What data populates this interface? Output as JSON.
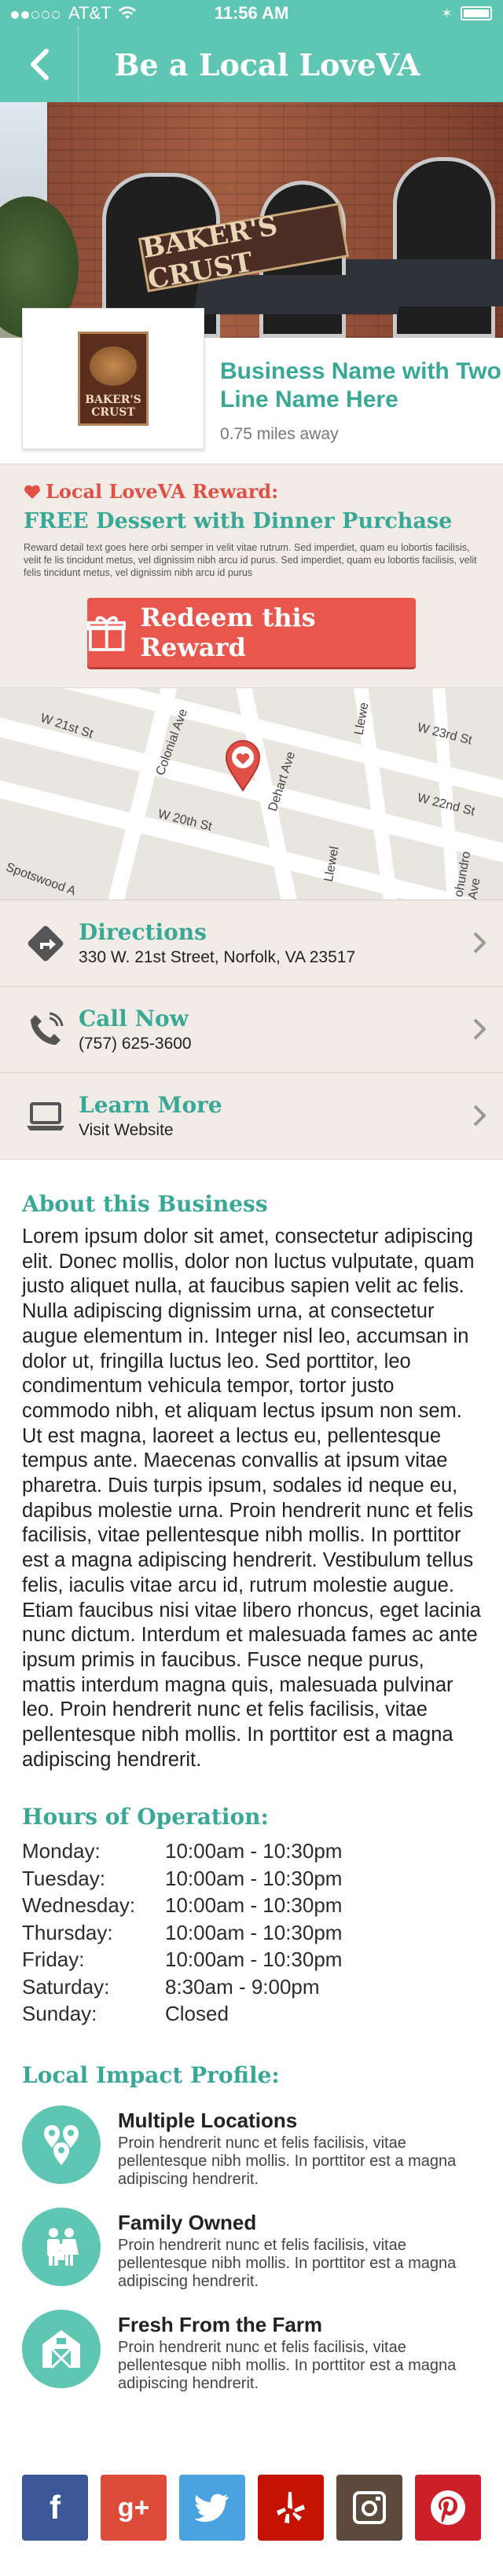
{
  "status_bar": {
    "carrier": "AT&T",
    "time": "11:56 AM"
  },
  "nav": {
    "title": "Be a Local LoveVA"
  },
  "hero": {
    "sign_text": "BAKER'S CRUST"
  },
  "business": {
    "name": "Business Name with Two Line Name Here",
    "distance": "0.75 miles away",
    "logo_text": "BAKER'S CRUST"
  },
  "reward": {
    "label": "Local LoveVA Reward:",
    "offer": "FREE Dessert with Dinner Purchase",
    "detail": "Reward detail text goes here orbi semper in velit vitae rutrum. Sed imperdiet, quam eu lobortis facilisis, velit fe lis tincidunt metus, vel dignissim nibh arcu id purus. Sed imperdiet, quam eu lobortis facilisis, velit felis tincidunt metus, vel dignissim nibh arcu id purus",
    "button_label": "Redeem this Reward"
  },
  "map": {
    "labels": [
      "W 21st St",
      "Colonial Ave",
      "Dehart Ave",
      "Llewe",
      "W 23rd St",
      "W 22nd St",
      "W 20th St",
      "Spotswood A",
      "Llewel",
      "ohundro Ave"
    ]
  },
  "actions": [
    {
      "title": "Directions",
      "subtitle": "330 W. 21st Street, Norfolk, VA 23517",
      "icon": "directions-icon"
    },
    {
      "title": "Call Now",
      "subtitle": "(757) 625-3600",
      "icon": "phone-icon"
    },
    {
      "title": "Learn More",
      "subtitle": "Visit Website",
      "icon": "laptop-icon"
    }
  ],
  "about": {
    "title": "About this Business",
    "body": "Lorem ipsum dolor sit amet, consectetur adipiscing elit. Donec mollis, dolor non luctus vulputate, quam justo aliquet nulla, at faucibus sapien velit ac felis. Nulla adipiscing dignissim urna, at consectetur augue elementum in. Integer nisl leo, accumsan in dolor ut, fringilla luctus leo. Sed porttitor, leo condimentum vehicula tempor, tortor justo commodo nibh, et aliquam lectus ipsum non sem. Ut est magna, laoreet a lectus eu, pellentesque tempus ante. Maecenas convallis at ipsum vitae pharetra. Duis turpis ipsum, sodales id neque eu, dapibus molestie urna. Proin hendrerit nunc et felis facilisis, vitae pellentesque nibh mollis. In porttitor est a magna adipiscing hendrerit. Vestibulum tellus felis, iaculis vitae arcu id, rutrum molestie augue. Etiam faucibus nisi vitae libero rhoncus, eget lacinia nunc dictum. Interdum et malesuada fames ac ante ipsum primis in faucibus. Fusce neque purus, mattis interdum magna quis, malesuada pulvinar leo. Proin hendrerit nunc et felis facilisis, vitae pellentesque nibh mollis. In porttitor est a magna adipiscing hendrerit."
  },
  "hours": {
    "title": "Hours of Operation:",
    "rows": [
      {
        "day": "Monday:",
        "time": "10:00am - 10:30pm"
      },
      {
        "day": "Tuesday:",
        "time": "10:00am - 10:30pm"
      },
      {
        "day": "Wednesday:",
        "time": "10:00am - 10:30pm"
      },
      {
        "day": "Thursday:",
        "time": "10:00am - 10:30pm"
      },
      {
        "day": "Friday:",
        "time": "10:00am - 10:30pm"
      },
      {
        "day": "Saturday:",
        "time": "8:30am - 9:00pm"
      },
      {
        "day": "Sunday:",
        "time": "Closed"
      }
    ]
  },
  "impact": {
    "title": "Local Impact Profile:",
    "items": [
      {
        "title": "Multiple Locations",
        "desc": "Proin hendrerit nunc et felis facilisis, vitae pellentesque nibh mollis. In porttitor est a magna adipiscing hendrerit.",
        "icon": "location-pins-icon"
      },
      {
        "title": "Family Owned",
        "desc": "Proin hendrerit nunc et felis facilisis, vitae pellentesque nibh mollis. In porttitor est a magna adipiscing hendrerit.",
        "icon": "family-icon"
      },
      {
        "title": "Fresh From the Farm",
        "desc": "Proin hendrerit nunc et felis facilisis, vitae pellentesque nibh mollis. In porttitor est a magna adipiscing hendrerit.",
        "icon": "barn-icon"
      }
    ]
  },
  "social": [
    {
      "name": "facebook",
      "glyph": "f",
      "color": "#3b5998"
    },
    {
      "name": "google-plus",
      "glyph": "g+",
      "color": "#dd4b39"
    },
    {
      "name": "twitter",
      "glyph": "t",
      "color": "#4aa3df"
    },
    {
      "name": "yelp",
      "glyph": "y",
      "color": "#c41200"
    },
    {
      "name": "instagram",
      "glyph": "ig",
      "color": "#5c4a3d"
    },
    {
      "name": "pinterest",
      "glyph": "p",
      "color": "#cb2027"
    }
  ],
  "colors": {
    "accent": "#5fc6b3",
    "title_teal": "#3aa896",
    "reward_red": "#e8564d",
    "paper": "#f1ede6"
  }
}
